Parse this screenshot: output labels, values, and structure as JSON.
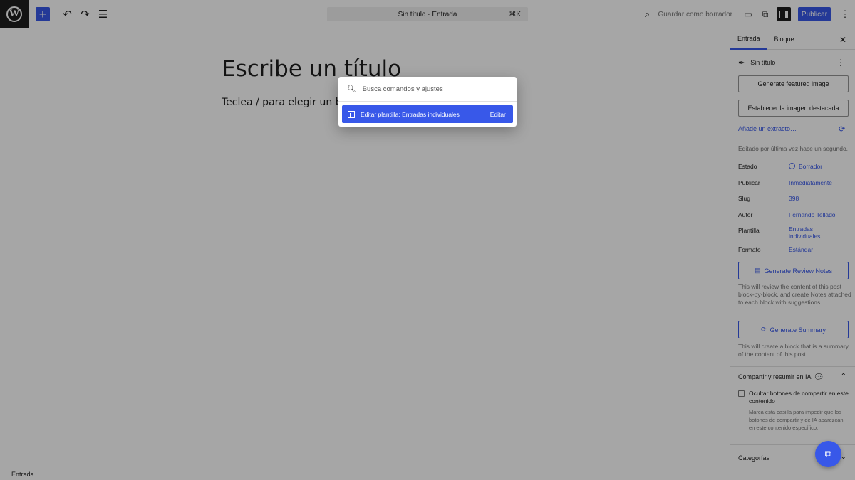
{
  "topbar": {
    "document_bar_title": "Sin título · Entrada",
    "shortcut": "⌘K",
    "save_draft_label": "Guardar como borrador",
    "publish_label": "Publicar"
  },
  "editor": {
    "title_placeholder": "Escribe un título",
    "block_placeholder": "Teclea / para elegir un bloque"
  },
  "command_palette": {
    "search_placeholder": "Busca comandos y ajustes",
    "result_label": "Editar plantilla: Entradas individuales",
    "result_action": "Editar"
  },
  "sidebar": {
    "tabs": [
      {
        "label": "Entrada",
        "active": true
      },
      {
        "label": "Bloque",
        "active": false
      }
    ],
    "post_title": "Sin título",
    "generate_featured_image": "Generate featured image",
    "set_featured_image": "Establecer la imagen destacada",
    "add_excerpt": "Añade un extracto…",
    "last_edited": "Editado por última vez hace un segundo.",
    "meta": [
      {
        "key": "Estado",
        "value": "Borrador"
      },
      {
        "key": "Publicar",
        "value": "Inmediatamente"
      },
      {
        "key": "Slug",
        "value": "398"
      },
      {
        "key": "Autor",
        "value": "Fernando Tellado"
      },
      {
        "key": "Plantilla",
        "value": "Entradas individuales"
      },
      {
        "key": "Formato",
        "value": "Estándar"
      }
    ],
    "review_notes_button": "Generate Review Notes",
    "review_notes_desc": "This will review the content of this post block-by-block, and create Notes attached to each block with suggestions.",
    "summary_button": "Generate Summary",
    "summary_desc": "This will create a block that is a summary of the content of this post.",
    "share_section_title": "Compartir y resumir en IA",
    "share_checkbox_label": "Ocultar botones de compartir en este contenido",
    "share_checkbox_checked": false,
    "share_help": "Marca esta casilla para impedir que los botones de compartir y de IA aparezcan en este contenido específico.",
    "categories_title": "Categorías"
  },
  "statusbar": {
    "breadcrumb": "Entrada"
  },
  "colors": {
    "accent": "#3858e9",
    "dark": "#1e1e1e"
  }
}
